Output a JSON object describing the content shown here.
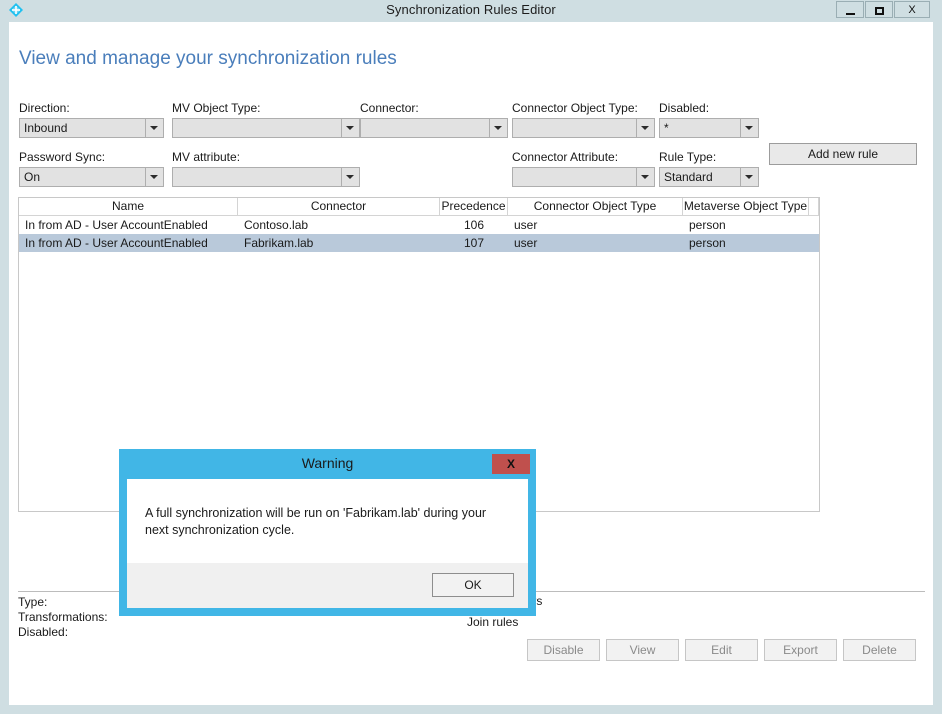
{
  "window": {
    "title": "Synchronization Rules Editor",
    "icon": "diamond-app-icon",
    "controls": {
      "minimize": "minimize-icon",
      "maximize": "maximize-icon",
      "close": "X"
    },
    "frame_color": "#cfdee2"
  },
  "page": {
    "heading": "View and manage your synchronization rules",
    "heading_color": "#4a7ebb"
  },
  "filters": {
    "direction": {
      "label": "Direction:",
      "value": "Inbound"
    },
    "mv_object_type": {
      "label": "MV Object Type:",
      "value": ""
    },
    "connector": {
      "label": "Connector:",
      "value": ""
    },
    "connector_object_type": {
      "label": "Connector Object Type:",
      "value": ""
    },
    "disabled": {
      "label": "Disabled:",
      "value": "*"
    },
    "password_sync": {
      "label": "Password Sync:",
      "value": "On"
    },
    "mv_attribute": {
      "label": "MV attribute:",
      "value": ""
    },
    "connector_attribute": {
      "label": "Connector Attribute:",
      "value": ""
    },
    "rule_type": {
      "label": "Rule Type:",
      "value": "Standard"
    }
  },
  "toolbar": {
    "add_new_rule": "Add new rule"
  },
  "grid": {
    "columns": [
      "Name",
      "Connector",
      "Precedence",
      "Connector Object Type",
      "Metaverse Object Type"
    ],
    "rows": [
      {
        "name": "In from AD - User AccountEnabled",
        "connector": "Contoso.lab",
        "precedence": "106",
        "connector_object_type": "user",
        "metaverse_object_type": "person",
        "selected": false
      },
      {
        "name": "In from AD - User AccountEnabled",
        "connector": "Fabrikam.lab",
        "precedence": "107",
        "connector_object_type": "user",
        "metaverse_object_type": "person",
        "selected": true
      }
    ],
    "selected_row_color": "#b9c9da"
  },
  "details": {
    "type_label": "Type:",
    "transformations_label": "Transformations:",
    "disabled_label": "Disabled:",
    "scoping_filters_label": "Scoping filters",
    "join_rules_label": "Join rules"
  },
  "actions": [
    {
      "label": "Disable"
    },
    {
      "label": "View"
    },
    {
      "label": "Edit"
    },
    {
      "label": "Export"
    },
    {
      "label": "Delete"
    }
  ],
  "dialog": {
    "title": "Warning",
    "close_label": "X",
    "close_color": "#c0504d",
    "accent_color": "#41b6e6",
    "message": "A full synchronization will be run on 'Fabrikam.lab' during your next synchronization cycle.",
    "ok_label": "OK"
  }
}
